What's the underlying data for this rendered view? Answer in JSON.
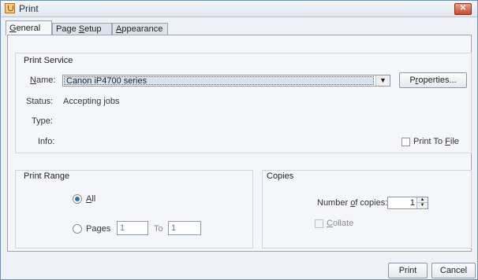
{
  "window": {
    "title": "Print",
    "close_glyph": "✕",
    "app_icon": "java-cup-icon"
  },
  "tabs": [
    {
      "label_mn": "G",
      "label_rest": "eneral"
    },
    {
      "label_pre": "Page ",
      "label_mn": "S",
      "label_rest": "etup"
    },
    {
      "label_mn": "A",
      "label_rest": "ppearance"
    }
  ],
  "print_service": {
    "section_title": "Print Service",
    "name_mn": "N",
    "name_rest": "ame:",
    "printer_selected": "Canon iP4700 series",
    "properties_pre": "P",
    "properties_mn": "r",
    "properties_rest": "operties...",
    "status_label": "Status:",
    "status_value": "Accepting jobs",
    "type_label": "Type:",
    "info_label": "Info:",
    "print_to_file_pre": "Print To ",
    "print_to_file_mn": "F",
    "print_to_file_rest": "ile",
    "print_to_file_checked": false
  },
  "print_range": {
    "section_title": "Print Range",
    "all_mn": "A",
    "all_rest": "ll",
    "all_selected": true,
    "pages_pre": "Pa",
    "pages_mn": "g",
    "pages_rest": "es",
    "pages_from": "1",
    "to_label": "To",
    "pages_to": "1"
  },
  "copies": {
    "section_title": "Copies",
    "number_pre": "Number ",
    "number_mn": "o",
    "number_rest": "f copies:",
    "count": "1",
    "collate_mn": "C",
    "collate_rest": "ollate",
    "collate_enabled": false
  },
  "footer": {
    "print_label": "Print",
    "cancel_label": "Cancel"
  },
  "colors": {
    "accent": "#3a6ea5",
    "window_border": "#6f8fb1",
    "close_button": "#c74b2d"
  }
}
